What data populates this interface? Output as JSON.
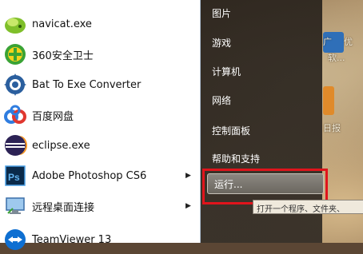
{
  "programs": [
    {
      "label": "navicat.exe",
      "icon": "navicat-icon",
      "has_submenu": false
    },
    {
      "label": "360安全卫士",
      "icon": "360-safe-icon",
      "has_submenu": false
    },
    {
      "label": "Bat To Exe Converter",
      "icon": "bat-to-exe-icon",
      "has_submenu": false
    },
    {
      "label": "百度网盘",
      "icon": "baidu-netdisk-icon",
      "has_submenu": false
    },
    {
      "label": "eclipse.exe",
      "icon": "eclipse-icon",
      "has_submenu": false
    },
    {
      "label": "Adobe Photoshop CS6",
      "icon": "photoshop-icon",
      "has_submenu": true
    },
    {
      "label": "远程桌面连接",
      "icon": "remote-desktop-icon",
      "has_submenu": true
    },
    {
      "label": "TeamViewer 13",
      "icon": "teamviewer-icon",
      "has_submenu": false
    }
  ],
  "right_panel": {
    "items": [
      "图片",
      "游戏",
      "计算机",
      "网络",
      "控制面板",
      "帮助和支持"
    ],
    "run_label": "运行...",
    "tooltip": "打开一个程序、文件夹、"
  },
  "desktop": {
    "texts": [
      "广",
      "优",
      "软...",
      "日报"
    ]
  },
  "colors": {
    "highlight": "#e0141c",
    "panel_dark": "#2e2822"
  }
}
